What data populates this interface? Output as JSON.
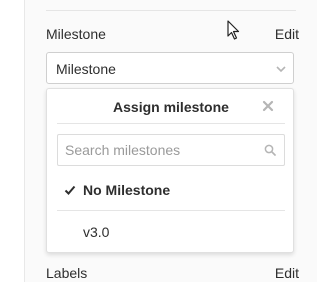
{
  "milestone": {
    "title": "Milestone",
    "edit_label": "Edit",
    "toggle_text": "Milestone"
  },
  "dropdown": {
    "title": "Assign milestone",
    "search_placeholder": "Search milestones",
    "items": [
      {
        "label": "No Milestone",
        "selected": true
      },
      {
        "label": "v3.0",
        "selected": false
      }
    ]
  },
  "labels": {
    "title": "Labels",
    "edit_label": "Edit"
  },
  "icons": {
    "chevron": "chevron-down-icon",
    "close": "close-icon",
    "search": "search-icon",
    "check": "check-icon",
    "cursor": "mouse-cursor-icon"
  },
  "colors": {
    "sidebar_bg": "#fafafa",
    "border": "#cfcfcf",
    "icon_gray": "#b5b5b5"
  }
}
